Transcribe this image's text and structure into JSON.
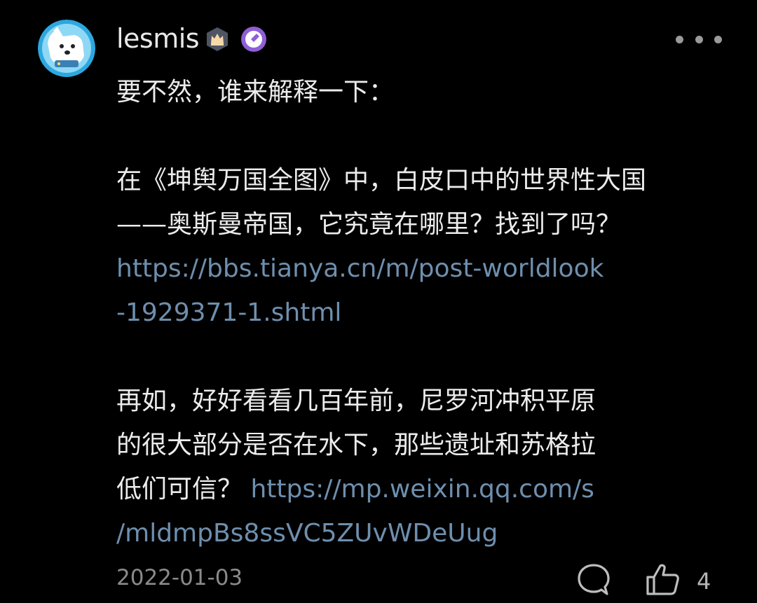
{
  "post": {
    "username": "lesmis",
    "badges": [
      "crown-badge",
      "pen-badge"
    ],
    "lines": [
      {
        "parts": [
          {
            "text": "要不然，谁来解释一下："
          }
        ]
      },
      {
        "parts": []
      },
      {
        "parts": [
          {
            "text": "在《坤舆万国全图》中，白皮口中的世界性大国"
          }
        ]
      },
      {
        "parts": [
          {
            "text": "——奥斯曼帝国，它究竟在哪里？找到了吗？"
          }
        ]
      },
      {
        "parts": [
          {
            "text": "https://bbs.tianya.cn/m/post-worldlook",
            "link": true
          }
        ]
      },
      {
        "parts": [
          {
            "text": "-1929371-1.shtml",
            "link": true
          }
        ]
      },
      {
        "parts": []
      },
      {
        "parts": [
          {
            "text": "再如，好好看看几百年前，尼罗河冲积平原"
          }
        ]
      },
      {
        "parts": [
          {
            "text": "的很大部分是否在水下，那些遗址和苏格拉"
          }
        ]
      },
      {
        "parts": [
          {
            "text": "低们可信？"
          },
          {
            "text": " https://mp.weixin.qq.com/s",
            "link": true
          }
        ]
      },
      {
        "parts": [
          {
            "text": "/mldmpBs8ssVC5ZUvWDeUug",
            "link": true
          }
        ]
      }
    ],
    "date": "2022-01-03",
    "like_count": "4"
  },
  "icons": {
    "more": "more-horizontal-icon",
    "comment": "comment-bubble-icon",
    "like": "thumbs-up-icon"
  },
  "colors": {
    "background": "#000000",
    "text": "#ececec",
    "link": "#6e8fae",
    "meta": "#8a8a8a",
    "badge_pen": "#8f5fd6",
    "badge_crown": "#4f5563"
  }
}
